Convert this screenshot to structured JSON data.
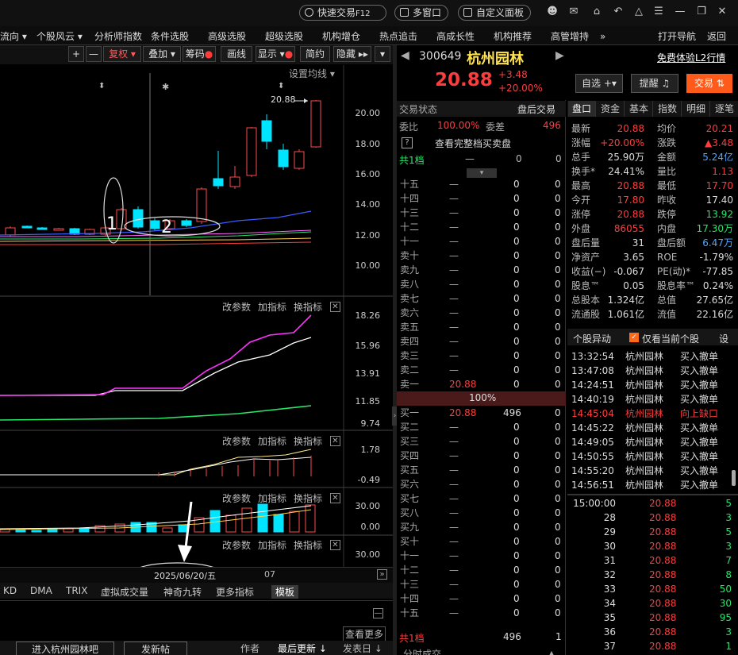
{
  "topbar": {
    "quick_trade": "快速交易",
    "quick_trade_key": "F12",
    "multi_window": "多窗口",
    "custom_panel": "自定义面板"
  },
  "menu": [
    "流向",
    "个股风云",
    "分析师指数",
    "条件选股",
    "高级选股",
    "超级选股",
    "机构增仓",
    "热点追击",
    "高成长性",
    "机构推荐",
    "高管增持",
    "»",
    "打开导航",
    "返回"
  ],
  "toolbar": {
    "plus": "+",
    "minus": "—",
    "fuquan": "复权",
    "diejia": "叠加",
    "chouma": "筹码",
    "huaxian": "画线",
    "xianshi": "显示",
    "jianyue": "简约",
    "yincang": "隐藏"
  },
  "stock": {
    "code": "300649",
    "name": "杭州园林",
    "price": "20.88",
    "change": "+3.48",
    "pct": "+20.00%",
    "free_l2": "免费体验L2行情",
    "btn_zixuan": "自选",
    "btn_tixing": "提醒",
    "btn_jiaoyi": "交易"
  },
  "chart": {
    "set_ma": "设置均线",
    "max_label": "20.88",
    "date_label": "2025/06/20/五",
    "month_label": "07",
    "y_main": [
      "20.00",
      "18.00",
      "16.00",
      "14.00",
      "12.00",
      "10.00"
    ],
    "anno1": "1",
    "anno2": "2",
    "marker_a": "⬍",
    "marker_b": "✱",
    "marker_c": "⬍"
  },
  "subpanels": {
    "change_param": "改参数",
    "add_ind": "加指标",
    "switch_ind": "换指标",
    "p1_y": [
      "18.26",
      "15.96",
      "13.91",
      "11.85",
      "9.74"
    ],
    "p2_y": [
      "1.78",
      "-0.49"
    ],
    "p3_y": [
      "30.00",
      "0.00"
    ],
    "p4_y": [
      "30.00"
    ]
  },
  "bottom_tabs": [
    "KD",
    "DMA",
    "TRIX",
    "虚拟成交量",
    "神奇九转",
    "更多指标",
    "模板"
  ],
  "forum": {
    "enter": "进入杭州园林吧",
    "post": "发新帖",
    "author": "作者",
    "latest": "最后更新",
    "post_date": "发表日",
    "view_more": "查看更多"
  },
  "orderbook": {
    "header_left": "交易状态",
    "header_right": "盘后交易",
    "weibi_label": "委比",
    "weibi_val": "100.00%",
    "weicha_label": "委差",
    "weicha_val": "496",
    "q_icon": "?",
    "full_book": "查看完整档买卖盘",
    "total1": "共1档",
    "mid_pct": "100%",
    "bottom_total": "共1档",
    "bottom_qty": "496",
    "bottom_n": "1",
    "trades_label": "分时成交",
    "upper": [
      [
        "十五",
        "—",
        "0",
        "0"
      ],
      [
        "十四",
        "—",
        "0",
        "0"
      ],
      [
        "十三",
        "—",
        "0",
        "0"
      ],
      [
        "十二",
        "—",
        "0",
        "0"
      ],
      [
        "十一",
        "—",
        "0",
        "0"
      ],
      [
        "卖十",
        "—",
        "0",
        "0"
      ],
      [
        "卖九",
        "—",
        "0",
        "0"
      ],
      [
        "卖八",
        "—",
        "0",
        "0"
      ],
      [
        "卖七",
        "—",
        "0",
        "0"
      ],
      [
        "卖六",
        "—",
        "0",
        "0"
      ],
      [
        "卖五",
        "—",
        "0",
        "0"
      ],
      [
        "卖四",
        "—",
        "0",
        "0"
      ],
      [
        "卖三",
        "—",
        "0",
        "0"
      ],
      [
        "卖二",
        "—",
        "0",
        "0"
      ],
      [
        "卖一",
        "20.88",
        "0",
        "0"
      ]
    ],
    "lower": [
      [
        "买一",
        "20.88",
        "496",
        "0"
      ],
      [
        "买二",
        "—",
        "0",
        "0"
      ],
      [
        "买三",
        "—",
        "0",
        "0"
      ],
      [
        "买四",
        "—",
        "0",
        "0"
      ],
      [
        "买五",
        "—",
        "0",
        "0"
      ],
      [
        "买六",
        "—",
        "0",
        "0"
      ],
      [
        "买七",
        "—",
        "0",
        "0"
      ],
      [
        "买八",
        "—",
        "0",
        "0"
      ],
      [
        "买九",
        "—",
        "0",
        "0"
      ],
      [
        "买十",
        "—",
        "0",
        "0"
      ],
      [
        "十一",
        "—",
        "0",
        "0"
      ],
      [
        "十二",
        "—",
        "0",
        "0"
      ],
      [
        "十三",
        "—",
        "0",
        "0"
      ],
      [
        "十四",
        "—",
        "0",
        "0"
      ],
      [
        "十五",
        "—",
        "0",
        "0"
      ]
    ],
    "total_row": [
      "—",
      "0",
      "0"
    ]
  },
  "quote_tabs": [
    "盘口",
    "资金",
    "基本",
    "指数",
    "明细",
    "逐笔"
  ],
  "quote": [
    [
      "最新",
      "20.88",
      "均价",
      "20.21"
    ],
    [
      "涨幅",
      "+20.00%",
      "涨跌",
      "▲3.48"
    ],
    [
      "总手",
      "25.90万",
      "金额",
      "5.24亿"
    ],
    [
      "换手*",
      "24.41%",
      "量比",
      "1.13"
    ],
    [
      "最高",
      "20.88",
      "最低",
      "17.70"
    ],
    [
      "今开",
      "17.80",
      "昨收",
      "17.40"
    ],
    [
      "涨停",
      "20.88",
      "跌停",
      "13.92"
    ],
    [
      "外盘",
      "86055",
      "内盘",
      "17.30万"
    ],
    [
      "盘后量",
      "31",
      "盘后额",
      "6.47万"
    ],
    [
      "净资产",
      "3.65",
      "ROE",
      "-1.79%"
    ],
    [
      "收益(−)",
      "-0.067",
      "PE(动)*",
      "-77.85"
    ],
    [
      "股息™",
      "0.05",
      "股息率™",
      "0.24%"
    ],
    [
      "总股本",
      "1.324亿",
      "总值",
      "27.65亿"
    ],
    [
      "流通股",
      "1.061亿",
      "流值",
      "22.16亿"
    ]
  ],
  "events": {
    "title": "个股异动",
    "only_current": "仅看当前个股",
    "settings": "设",
    "rows": [
      [
        "13:32:54",
        "杭州园林",
        "买入撤单"
      ],
      [
        "13:47:08",
        "杭州园林",
        "买入撤单"
      ],
      [
        "14:24:51",
        "杭州园林",
        "买入撤单"
      ],
      [
        "14:40:19",
        "杭州园林",
        "买入撤单"
      ],
      [
        "14:45:04",
        "杭州园林",
        "向上缺口"
      ],
      [
        "14:45:22",
        "杭州园林",
        "买入撤单"
      ],
      [
        "14:49:05",
        "杭州园林",
        "买入撤单"
      ],
      [
        "14:50:55",
        "杭州园林",
        "买入撤单"
      ],
      [
        "14:55:20",
        "杭州园林",
        "买入撤单"
      ],
      [
        "14:56:51",
        "杭州园林",
        "买入撤单"
      ]
    ]
  },
  "ticks": [
    [
      "15:00:00",
      "20.88",
      "5"
    ],
    [
      "28",
      "20.88",
      "3"
    ],
    [
      "29",
      "20.88",
      "5"
    ],
    [
      "30",
      "20.88",
      "3"
    ],
    [
      "31",
      "20.88",
      "7"
    ],
    [
      "32",
      "20.88",
      "8"
    ],
    [
      "33",
      "20.88",
      "50"
    ],
    [
      "34",
      "20.88",
      "30"
    ],
    [
      "35",
      "20.88",
      "95"
    ],
    [
      "36",
      "20.88",
      "3"
    ],
    [
      "37",
      "20.88",
      "1"
    ]
  ],
  "colors": {
    "up": "#ff3c3c",
    "down": "#27e66a",
    "cyan": "#00e5ff",
    "text": "#dddddd",
    "accent_orange": "#ff6a1a"
  }
}
